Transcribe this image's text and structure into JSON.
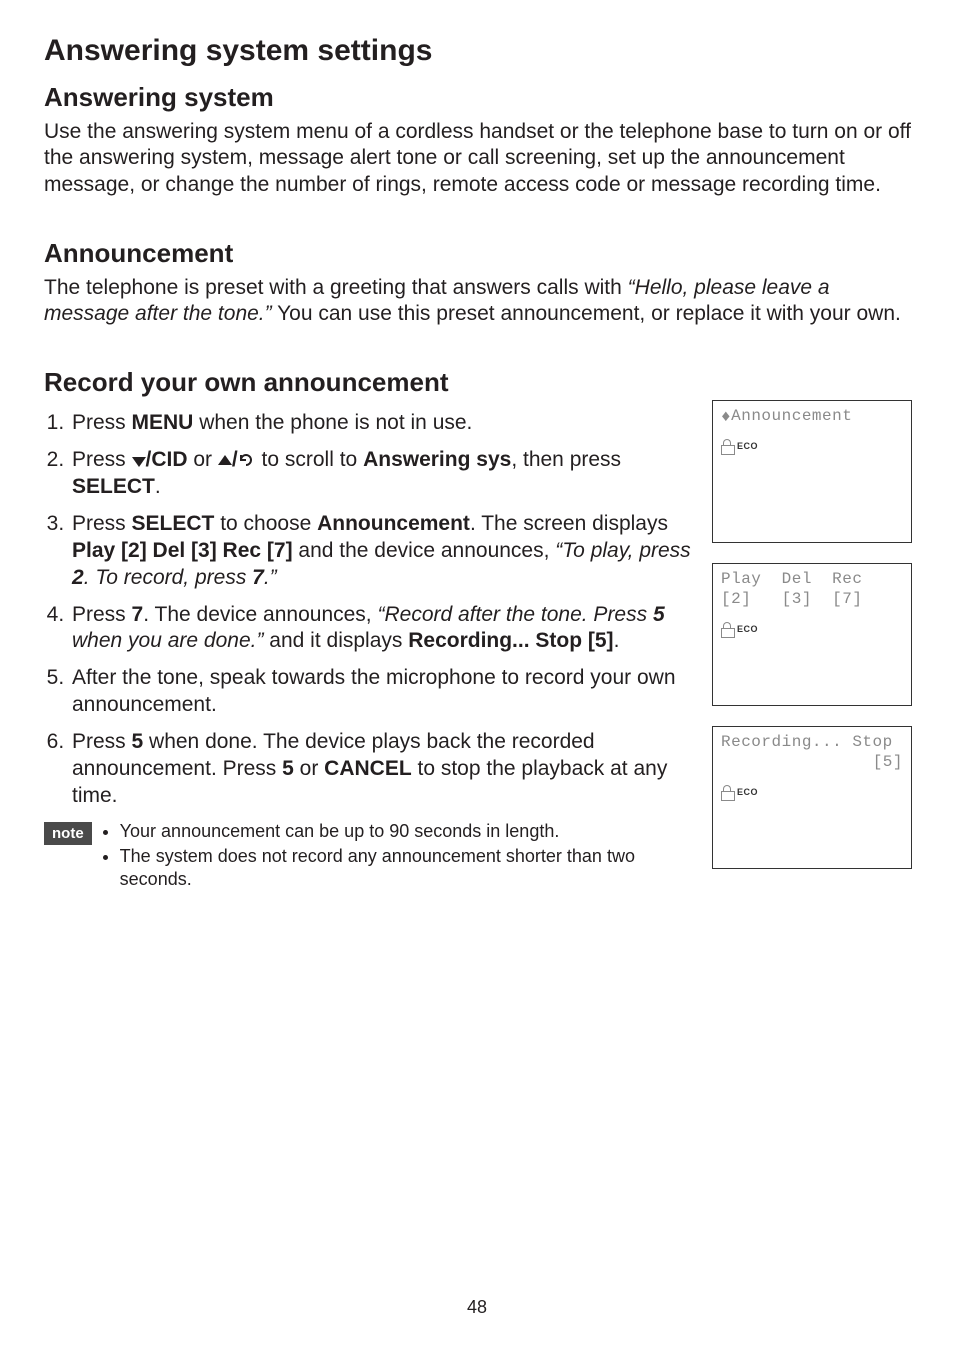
{
  "page_number": "48",
  "title": "Answering system settings",
  "section1": {
    "heading": "Answering system",
    "body": "Use the answering system menu of a cordless handset or the telephone base to turn on or off the answering system, message alert tone or call screening, set up the announcement message, or change the number of rings, remote access code or message recording time."
  },
  "section2": {
    "heading": "Announcement",
    "body_pre": "The telephone is preset with a greeting that answers calls with ",
    "body_quote": "“Hello, please leave a message after the tone.”",
    "body_post": "  You can use this preset announcement, or replace it with your own."
  },
  "section3": {
    "heading": "Record your own announcement",
    "steps": {
      "s1_a": "Press ",
      "s1_b": "MENU",
      "s1_c": " when the phone is not in use.",
      "s2_a": "Press ",
      "s2_b": "/CID",
      "s2_c": " or ",
      "s2_d": "/",
      "s2_e": " to scroll to ",
      "s2_f": "Answering sys",
      "s2_g": ", then press ",
      "s2_h": "SELECT",
      "s2_i": ".",
      "s3_a": "Press ",
      "s3_b": "SELECT",
      "s3_c": " to choose ",
      "s3_d": "Announcement",
      "s3_e": ". The screen displays ",
      "s3_f": "Play [2] Del [3] Rec [7]",
      "s3_g": " and the device announces, ",
      "s3_h": "“To play, press ",
      "s3_h2": "2",
      "s3_h3": ". To record, press ",
      "s3_h4": "7",
      "s3_h5": ".”",
      "s4_a": "Press ",
      "s4_b": "7",
      "s4_c": ". The device announces, ",
      "s4_d": "“Record after the tone. Press ",
      "s4_d2": "5",
      "s4_d3": " when you are done.”",
      "s4_e": "  and it displays ",
      "s4_f": "Recording... Stop [5]",
      "s4_g": ".",
      "s5": "After the tone, speak towards the microphone to record your own announcement.",
      "s6_a": "Press ",
      "s6_b": "5",
      "s6_c": " when done. The device plays back the recorded announcement. Press ",
      "s6_d": "5",
      "s6_e": " or ",
      "s6_f": "CANCEL",
      "s6_g": " to stop the playback at any time."
    }
  },
  "note": {
    "label": "note",
    "items": [
      "Your announcement can be up to 90 seconds in length.",
      "The system does not record any announcement shorter than two seconds."
    ]
  },
  "lcd": {
    "screen1_line1": "Announcement",
    "eco": "ECO",
    "screen2_row1": "Play  Del  Rec",
    "screen2_row2": "[2]   [3]  [7]",
    "screen3_row1": "Recording... Stop",
    "screen3_row2": "[5]"
  }
}
